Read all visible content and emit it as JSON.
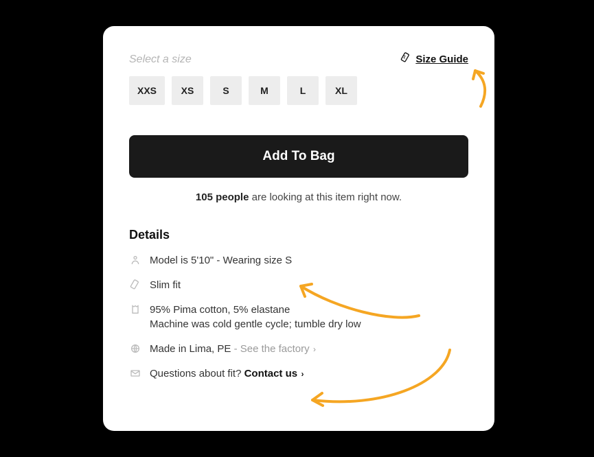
{
  "sizeSection": {
    "label": "Select a size",
    "guideLabel": "Size Guide",
    "options": [
      "XXS",
      "XS",
      "S",
      "M",
      "L",
      "XL"
    ]
  },
  "cta": {
    "addToBag": "Add To Bag"
  },
  "watching": {
    "countBold": "105 people",
    "suffix": " are looking at this item right now."
  },
  "details": {
    "heading": "Details",
    "model": "Model is 5'10\" - Wearing size S",
    "fit": "Slim fit",
    "materialLine1": "95% Pima cotton, 5% elastane",
    "materialLine2": "Machine was cold gentle cycle; tumble dry low",
    "madePrefix": "Made in Lima, PE ",
    "madeLink": "- See the factory",
    "questionsPrefix": "Questions about fit? ",
    "contactLabel": "Contact us"
  }
}
